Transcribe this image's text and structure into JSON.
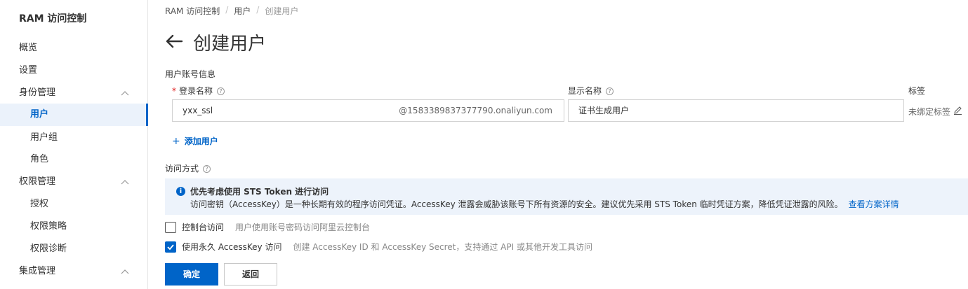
{
  "sidebar": {
    "title": "RAM 访问控制",
    "items": [
      {
        "label": "概览"
      },
      {
        "label": "设置"
      },
      {
        "label": "身份管理"
      },
      {
        "label": "用户"
      },
      {
        "label": "用户组"
      },
      {
        "label": "角色"
      },
      {
        "label": "权限管理"
      },
      {
        "label": "授权"
      },
      {
        "label": "权限策略"
      },
      {
        "label": "权限诊断"
      },
      {
        "label": "集成管理"
      }
    ]
  },
  "breadcrumb": [
    "RAM 访问控制",
    "用户",
    "创建用户"
  ],
  "page": {
    "title": "创建用户"
  },
  "user_info": {
    "section_label": "用户账号信息",
    "login_name_label": "登录名称",
    "display_name_label": "显示名称",
    "tags_label": "标签",
    "login_name_value": "yxx_ssl",
    "login_suffix": "@1583389837377790.onaliyun.com",
    "display_name_value": "证书生成用户",
    "tags_value": "未绑定标签",
    "add_user": "添加用户"
  },
  "access": {
    "section_label": "访问方式",
    "alert_title": "优先考虑使用 STS Token 进行访问",
    "alert_desc": "访问密钥（AccessKey）是一种长期有效的程序访问凭证。AccessKey 泄露会威胁该账号下所有资源的安全。建议优先采用 STS Token 临时凭证方案，降低凭证泄露的风险。",
    "alert_link": "查看方案详情",
    "options": [
      {
        "label": "控制台访问",
        "desc": "用户使用账号密码访问阿里云控制台",
        "checked": false
      },
      {
        "label": "使用永久 AccessKey 访问",
        "desc": "创建 AccessKey ID 和 AccessKey Secret，支持通过 API 或其他开发工具访问",
        "checked": true
      }
    ]
  },
  "buttons": {
    "confirm": "确定",
    "back": "返回"
  },
  "colors": {
    "accent": "#0064c8",
    "alert_bg": "#edf3fb"
  }
}
